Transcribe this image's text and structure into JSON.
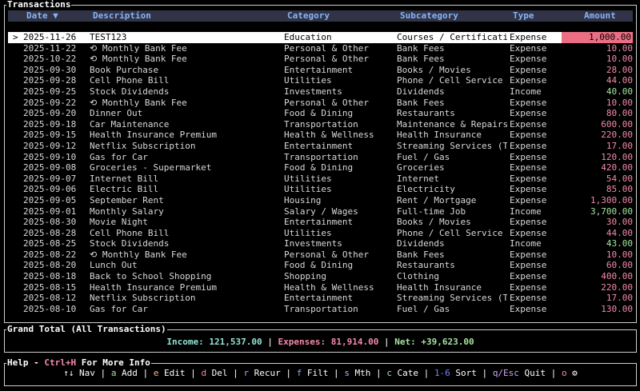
{
  "transactions_panel": {
    "title": "Transactions",
    "columns": {
      "date": "Date ▼",
      "description": "Description",
      "category": "Category",
      "subcategory": "Subcategory",
      "type": "Type",
      "amount": "Amount"
    },
    "selected_marker": ">",
    "rows": [
      {
        "date": "2025-11-26",
        "description": "TEST123",
        "category": "Education",
        "subcategory": "Courses / Certificati",
        "type": "Expense",
        "amount": "1,000.00",
        "selected": true
      },
      {
        "date": "2025-11-22",
        "description": "⟲ Monthly Bank Fee",
        "category": "Personal & Other",
        "subcategory": "Bank Fees",
        "type": "Expense",
        "amount": "10.00"
      },
      {
        "date": "2025-10-22",
        "description": "⟲ Monthly Bank Fee",
        "category": "Personal & Other",
        "subcategory": "Bank Fees",
        "type": "Expense",
        "amount": "10.00"
      },
      {
        "date": "2025-09-30",
        "description": "Book Purchase",
        "category": "Entertainment",
        "subcategory": "Books / Movies",
        "type": "Expense",
        "amount": "28.00"
      },
      {
        "date": "2025-09-28",
        "description": "Cell Phone Bill",
        "category": "Utilities",
        "subcategory": "Phone / Cell Service",
        "type": "Expense",
        "amount": "44.00"
      },
      {
        "date": "2025-09-25",
        "description": "Stock Dividends",
        "category": "Investments",
        "subcategory": "Dividends",
        "type": "Income",
        "amount": "40.00"
      },
      {
        "date": "2025-09-22",
        "description": "⟲ Monthly Bank Fee",
        "category": "Personal & Other",
        "subcategory": "Bank Fees",
        "type": "Expense",
        "amount": "10.00"
      },
      {
        "date": "2025-09-20",
        "description": "Dinner Out",
        "category": "Food & Dining",
        "subcategory": "Restaurants",
        "type": "Expense",
        "amount": "80.00"
      },
      {
        "date": "2025-09-18",
        "description": "Car Maintenance",
        "category": "Transportation",
        "subcategory": "Maintenance & Repairs",
        "type": "Expense",
        "amount": "600.00"
      },
      {
        "date": "2025-09-15",
        "description": "Health Insurance Premium",
        "category": "Health & Wellness",
        "subcategory": "Health Insurance",
        "type": "Expense",
        "amount": "220.00"
      },
      {
        "date": "2025-09-12",
        "description": "Netflix Subscription",
        "category": "Entertainment",
        "subcategory": "Streaming Services (T",
        "type": "Expense",
        "amount": "17.00"
      },
      {
        "date": "2025-09-10",
        "description": "Gas for Car",
        "category": "Transportation",
        "subcategory": "Fuel / Gas",
        "type": "Expense",
        "amount": "120.00"
      },
      {
        "date": "2025-09-08",
        "description": "Groceries - Supermarket",
        "category": "Food & Dining",
        "subcategory": "Groceries",
        "type": "Expense",
        "amount": "420.00"
      },
      {
        "date": "2025-09-07",
        "description": "Internet Bill",
        "category": "Utilities",
        "subcategory": "Internet",
        "type": "Expense",
        "amount": "54.00"
      },
      {
        "date": "2025-09-06",
        "description": "Electric Bill",
        "category": "Utilities",
        "subcategory": "Electricity",
        "type": "Expense",
        "amount": "85.00"
      },
      {
        "date": "2025-09-05",
        "description": "September Rent",
        "category": "Housing",
        "subcategory": "Rent / Mortgage",
        "type": "Expense",
        "amount": "1,300.00"
      },
      {
        "date": "2025-09-01",
        "description": "Monthly Salary",
        "category": "Salary / Wages",
        "subcategory": "Full-time Job",
        "type": "Income",
        "amount": "3,700.00"
      },
      {
        "date": "2025-08-30",
        "description": "Movie Night",
        "category": "Entertainment",
        "subcategory": "Books / Movies",
        "type": "Expense",
        "amount": "30.00"
      },
      {
        "date": "2025-08-28",
        "description": "Cell Phone Bill",
        "category": "Utilities",
        "subcategory": "Phone / Cell Service",
        "type": "Expense",
        "amount": "44.00"
      },
      {
        "date": "2025-08-25",
        "description": "Stock Dividends",
        "category": "Investments",
        "subcategory": "Dividends",
        "type": "Income",
        "amount": "43.00"
      },
      {
        "date": "2025-08-22",
        "description": "⟲ Monthly Bank Fee",
        "category": "Personal & Other",
        "subcategory": "Bank Fees",
        "type": "Expense",
        "amount": "10.00"
      },
      {
        "date": "2025-08-20",
        "description": "Lunch Out",
        "category": "Food & Dining",
        "subcategory": "Restaurants",
        "type": "Expense",
        "amount": "60.00"
      },
      {
        "date": "2025-08-18",
        "description": "Back to School Shopping",
        "category": "Shopping",
        "subcategory": "Clothing",
        "type": "Expense",
        "amount": "400.00"
      },
      {
        "date": "2025-08-15",
        "description": "Health Insurance Premium",
        "category": "Health & Wellness",
        "subcategory": "Health Insurance",
        "type": "Expense",
        "amount": "220.00"
      },
      {
        "date": "2025-08-12",
        "description": "Netflix Subscription",
        "category": "Entertainment",
        "subcategory": "Streaming Services (T",
        "type": "Expense",
        "amount": "17.00"
      },
      {
        "date": "2025-08-10",
        "description": "Gas for Car",
        "category": "Transportation",
        "subcategory": "Fuel / Gas",
        "type": "Expense",
        "amount": "130.00"
      }
    ]
  },
  "grand_total": {
    "title": "Grand Total (All Transactions)",
    "income": "Income: 121,537.00",
    "expenses": "Expenses: 81,914.00",
    "net": "Net: +39,623.00",
    "separator": "|"
  },
  "help": {
    "title_prefix": "Help - ",
    "title_key": "Ctrl+H",
    "title_suffix": " For More Info",
    "items": [
      {
        "key": "↑↓",
        "label": " Nav",
        "cls": ""
      },
      {
        "key": "a",
        "label": " Add",
        "cls": "k-a"
      },
      {
        "key": "e",
        "label": " Edit",
        "cls": "k-e"
      },
      {
        "key": "d",
        "label": " Del",
        "cls": "k-d"
      },
      {
        "key": "r",
        "label": " Recur",
        "cls": "k-r"
      },
      {
        "key": "f",
        "label": " Filt",
        "cls": "k-f"
      },
      {
        "key": "s",
        "label": " Mth",
        "cls": "k-s"
      },
      {
        "key": "c",
        "label": " Cate",
        "cls": "k-c"
      },
      {
        "key": "1-6",
        "label": " Sort",
        "cls": "k-sort"
      },
      {
        "key": "q/Esc",
        "label": " Quit",
        "cls": "k-q"
      },
      {
        "key": "o",
        "label": " ⚙",
        "cls": "k-o"
      }
    ]
  },
  "colors": {
    "header_bg": "#303446",
    "header_text": "#89b4fa",
    "expense": "#f38ba8",
    "income": "#a6e3a1",
    "selected_bg": "#ffffff",
    "selected_amount_bg": "#eb6f84"
  }
}
